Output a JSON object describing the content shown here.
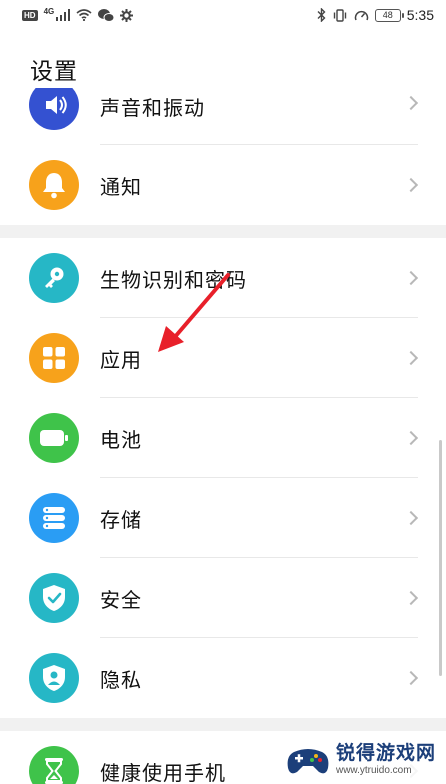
{
  "status_bar": {
    "hd": "HD",
    "network": "4G",
    "battery": "48",
    "time": "5:35"
  },
  "page_title": "设置",
  "items": [
    {
      "label": "声音和振动",
      "icon": "speaker-icon",
      "color": "#3451d1"
    },
    {
      "label": "通知",
      "icon": "bell-icon",
      "color": "#f7a21b"
    },
    {
      "label": "生物识别和密码",
      "icon": "key-icon",
      "color": "#26b7c6"
    },
    {
      "label": "应用",
      "icon": "grid-apps-icon",
      "color": "#f7a21b"
    },
    {
      "label": "电池",
      "icon": "battery-icon",
      "color": "#3fc34a"
    },
    {
      "label": "存储",
      "icon": "storage-icon",
      "color": "#2a9df4"
    },
    {
      "label": "安全",
      "icon": "shield-check-icon",
      "color": "#26b7c6"
    },
    {
      "label": "隐私",
      "icon": "privacy-shield-icon",
      "color": "#26b7c6"
    },
    {
      "label": "健康使用手机",
      "icon": "hourglass-icon",
      "color": "#3fc34a"
    }
  ],
  "watermark": {
    "title": "锐得游戏网",
    "url": "www.ytruido.com"
  }
}
